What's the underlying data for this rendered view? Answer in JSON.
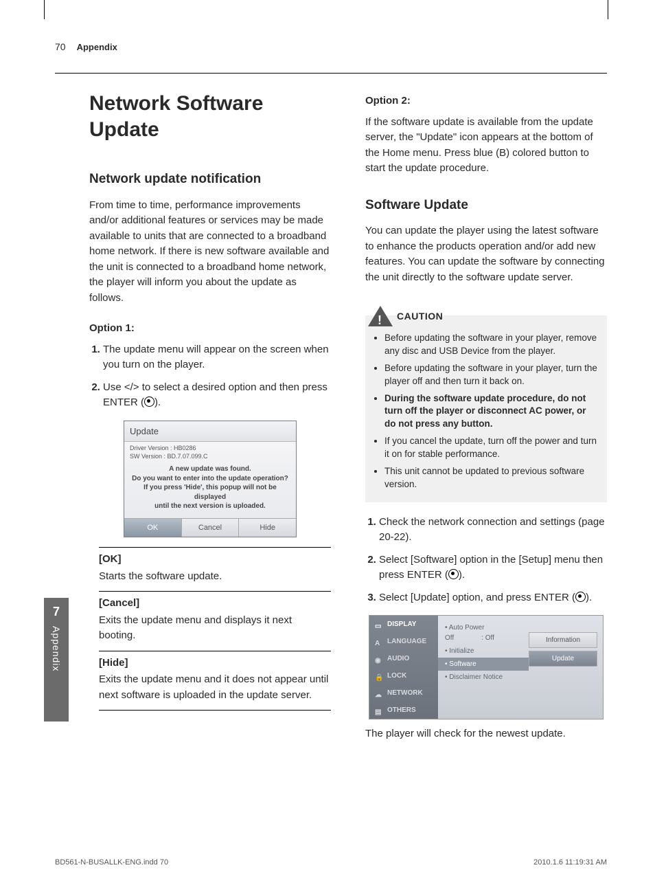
{
  "header": {
    "page": "70",
    "section": "Appendix"
  },
  "title": "Network Software Update",
  "h2a": "Network update notification",
  "intro": "From time to time, performance improvements and/or additional features or services may be made available to units that are connected to a broadband home network. If there is new software available and the unit is connected to a broadband home network, the player will inform you about the update as follows.",
  "opt1_h": "Option 1:",
  "opt1_steps": [
    "The update menu will appear on the screen when you turn on the player.",
    "Use </> to select a desired option and then press ENTER ("
  ],
  "dialog": {
    "title": "Update",
    "ver1": "Driver Version : HB0286",
    "ver2": "SW Version : BD.7.07.099.C",
    "line1": "A new update was found.",
    "line2": "Do you want to enter into the update operation?",
    "line3": "If you press 'Hide', this popup will not be displayed",
    "line4": "until the next version is uploaded.",
    "b1": "OK",
    "b2": "Cancel",
    "b3": "Hide"
  },
  "defs": {
    "l1": "[OK]",
    "d1": "Starts the software update.",
    "l2": "[Cancel]",
    "d2": "Exits the update menu and displays it next booting.",
    "l3": "[Hide]",
    "d3": "Exits the update menu and it does not appear until next software is uploaded in the update server."
  },
  "opt2_h": "Option 2:",
  "opt2_p": "If the software update is available from the update server, the \"Update\" icon appears at the bottom of the Home menu. Press blue (B) colored button to start the update procedure.",
  "h2b": "Software Update",
  "su_p": "You can update the player using the latest software to enhance the products operation and/or add new features. You can update the software by connecting the unit directly to the software update server.",
  "caution": {
    "title": "CAUTION",
    "items": [
      "Before updating the software in your player, remove any disc and USB Device from the player.",
      "Before updating the software in your player, turn the player off and then turn it back on.",
      "During the software update procedure, do not turn off the player or disconnect AC power, or do not press any button.",
      "If you cancel the update, turn off the power and turn it on for stable performance.",
      "This unit cannot be updated to previous software version."
    ]
  },
  "su_steps": [
    "Check the network connection and settings (page 20-22).",
    "Select [Software] option in the [Setup] menu then press ENTER (",
    "Select [Update] option, and press ENTER ("
  ],
  "setup": {
    "sidebar": [
      "DISPLAY",
      "LANGUAGE",
      "AUDIO",
      "LOCK",
      "NETWORK",
      "OTHERS"
    ],
    "mid": {
      "a": "• Auto Power Off",
      "a_val": ": Off",
      "b": "• Initialize",
      "c": "• Software",
      "d": "• Disclaimer Notice"
    },
    "right": {
      "r1": "Information",
      "r2": "Update"
    }
  },
  "after_ui": "The player will check for the newest update.",
  "side": {
    "num": "7",
    "txt": "Appendix"
  },
  "footer": {
    "left": "BD561-N-BUSALLK-ENG.indd   70",
    "right": "2010.1.6   11:19:31 AM"
  }
}
